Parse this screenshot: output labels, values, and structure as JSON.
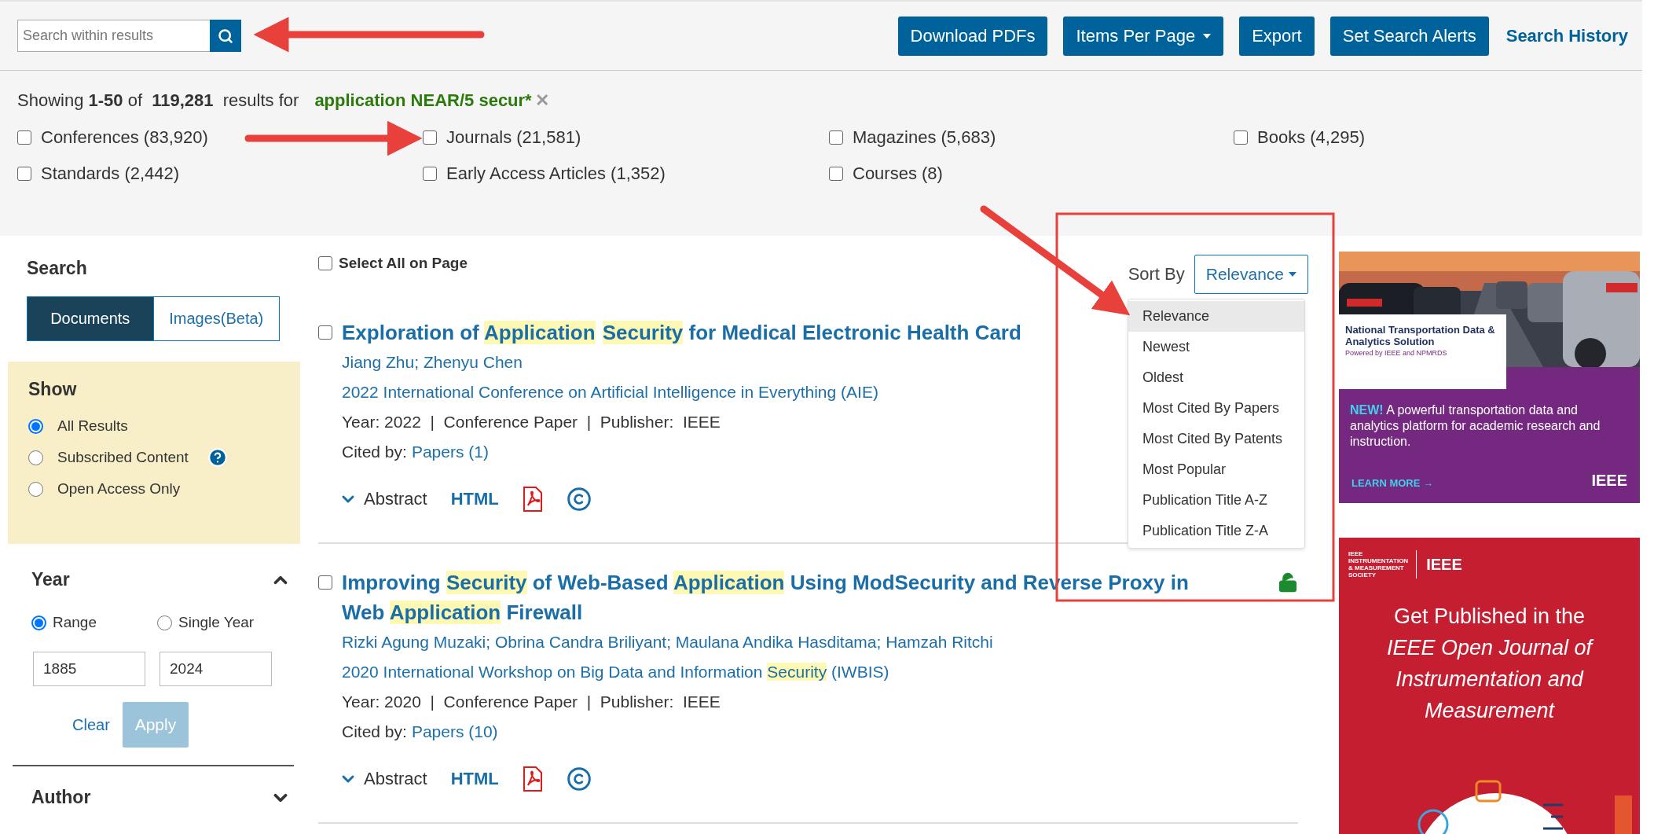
{
  "search_field": {
    "placeholder": "Search within results"
  },
  "toolbar_buttons": [
    {
      "label": "Download PDFs",
      "kind": "button"
    },
    {
      "label": "Items Per Page",
      "kind": "dropdown"
    },
    {
      "label": "Export",
      "kind": "button"
    },
    {
      "label": "Set Search Alerts",
      "kind": "button"
    },
    {
      "label": "Search History",
      "kind": "link"
    }
  ],
  "summary": {
    "text": "Showing **1-50** of  **119,281**  results for",
    "query": "application NEAR/5 secur*",
    "remove_icon": "✕"
  },
  "content_types": [
    {
      "label": "Conferences (83,920)",
      "checked": false
    },
    {
      "label": "Journals (21,581)",
      "checked": false
    },
    {
      "label": "Magazines (5,683)",
      "checked": false
    },
    {
      "label": "Books (4,295)",
      "checked": false
    },
    {
      "label": "Standards (2,442)",
      "checked": false
    },
    {
      "label": "Early Access Articles (1,352)",
      "checked": false
    },
    {
      "label": "Courses (8)",
      "checked": false
    }
  ],
  "sidebar": {
    "search_heading": "Search",
    "search_tabs": [
      {
        "label": "Documents",
        "selected": true
      },
      {
        "label": "Images(Beta)",
        "selected": false
      }
    ],
    "show": {
      "title": "Show",
      "options": [
        {
          "label": "All Results",
          "selected": true
        },
        {
          "label": "Subscribed Content",
          "selected": false,
          "help": true
        },
        {
          "label": "Open Access Only",
          "selected": false
        }
      ]
    },
    "year": {
      "title": "Year",
      "expanded": true,
      "modes": [
        {
          "label": "Range",
          "selected": true
        },
        {
          "label": "Single Year",
          "selected": false
        }
      ],
      "from": "1885",
      "to": "2024",
      "clear": "Clear",
      "apply": {
        "label": "Apply",
        "disabled": true
      }
    },
    "author": {
      "title": "Author",
      "expanded": false
    }
  },
  "results": {
    "select_all": {
      "label": "Select All on Page",
      "checked": false
    },
    "sort": {
      "label": "Sort By",
      "value": "Relevance",
      "expanded": true,
      "options": [
        {
          "label": "Relevance",
          "selected": true
        },
        {
          "label": "Newest",
          "selected": false
        },
        {
          "label": "Oldest",
          "selected": false
        },
        {
          "label": "Most Cited By Papers",
          "selected": false
        },
        {
          "label": "Most Cited By Patents",
          "selected": false
        },
        {
          "label": "Most Popular",
          "selected": false
        },
        {
          "label": "Publication Title A-Z",
          "selected": false
        },
        {
          "label": "Publication Title Z-A",
          "selected": false
        }
      ]
    },
    "items": [
      {
        "checked": false,
        "open_access": false,
        "title": [
          {
            "text": "Exploration of ",
            "highlighted": false
          },
          {
            "text": "Application",
            "highlighted": true,
            "space_after": true
          },
          {
            "text": "Security",
            "highlighted": true
          },
          {
            "text": " for Medical Electronic Health Card",
            "highlighted": false
          }
        ],
        "authors": "Jiang Zhu; Zhenyu Chen",
        "venue": [
          {
            "text": "2022 International Conference on Artificial Intelligence in Everything (AIE)",
            "highlighted": false
          }
        ],
        "meta": "Year: 2022  |  Conference Paper  |  Publisher:  IEEE",
        "cited_label": "Cited by:",
        "cited_link": "Papers (1)",
        "abstract": "Abstract",
        "html": "HTML"
      },
      {
        "checked": false,
        "open_access": true,
        "title": [
          {
            "text": "Improving ",
            "highlighted": false
          },
          {
            "text": "Security",
            "highlighted": true
          },
          {
            "text": " of Web-Based ",
            "highlighted": false
          },
          {
            "text": "Application",
            "highlighted": true
          },
          {
            "text": " Using ModSecurity and Reverse Proxy in Web ",
            "highlighted": false
          },
          {
            "text": "Application",
            "highlighted": true
          },
          {
            "text": " Firewall",
            "highlighted": false
          }
        ],
        "authors": "Rizki Agung Muzaki; Obrina Candra Briliyant; Maulana Andika Hasditama; Hamzah Ritchi",
        "venue": [
          {
            "text": "2020 International Workshop on Big Data and Information ",
            "highlighted": false
          },
          {
            "text": "Security",
            "highlighted": true
          },
          {
            "text": " (IWBIS)",
            "highlighted": false
          }
        ],
        "meta": "Year: 2020  |  Conference Paper  |  Publisher:  IEEE",
        "cited_label": "Cited by:",
        "cited_link": "Papers (10)",
        "abstract": "Abstract",
        "html": "HTML"
      }
    ]
  },
  "ads": [
    {
      "kind": "transport",
      "title": "National Transportation Data & Analytics Solution",
      "subtitle": "Powered by IEEE and NPMRDS",
      "badge": "NEW!",
      "text": "A powerful transportation data and analytics platform for academic research and instruction.",
      "cta": "LEARN MORE →",
      "brand": "IEEE"
    },
    {
      "kind": "journal",
      "society": [
        "IEEE",
        "INSTRUMENTATION",
        "& MEASUREMENT",
        "SOCIETY"
      ],
      "brand": "IEEE",
      "text": "Get Published in the",
      "emphasis": "IEEE Open Journal of Instrumentation and Measurement"
    }
  ]
}
